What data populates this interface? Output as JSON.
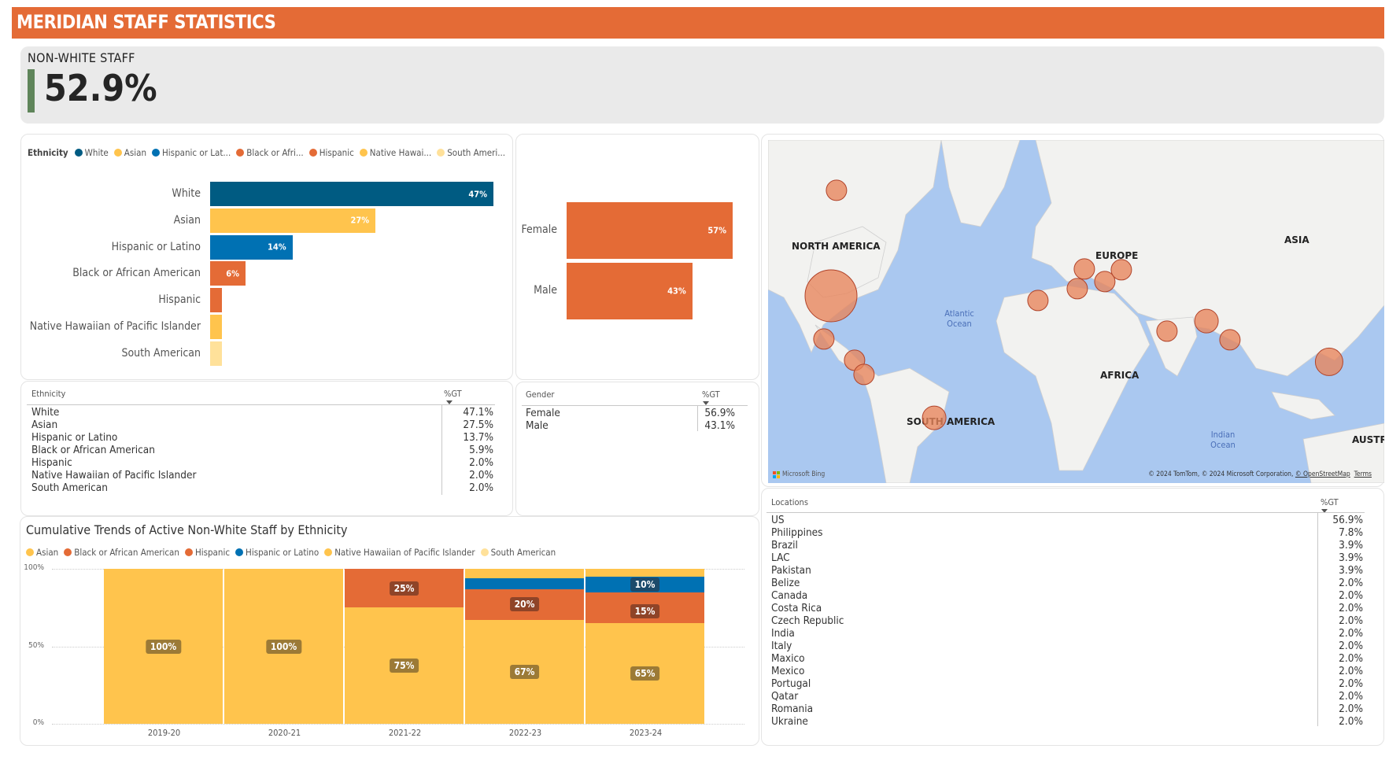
{
  "header": {
    "title": "MERIDIAN STAFF STATISTICS",
    "color": "#e46b36"
  },
  "kpi": {
    "label": "NON-WHITE STAFF",
    "value": "52.9%",
    "accent": "#5f855a"
  },
  "ethnicity_bar": {
    "legend_title": "Ethnicity",
    "legend": [
      {
        "label": "White",
        "color": "#005b82"
      },
      {
        "label": "Asian",
        "color": "#ffc44d"
      },
      {
        "label": "Hispanic or Lat...",
        "color": "#0071b3"
      },
      {
        "label": "Black or Afri...",
        "color": "#e46b36"
      },
      {
        "label": "Hispanic",
        "color": "#e46b36"
      },
      {
        "label": "Native Hawai...",
        "color": "#ffc44d"
      },
      {
        "label": "South Ameri...",
        "color": "#ffe19a"
      }
    ],
    "bars": [
      {
        "label": "White",
        "value": 47.1,
        "display": "47%",
        "color": "#005b82"
      },
      {
        "label": "Asian",
        "value": 27.5,
        "display": "27%",
        "color": "#ffc44d"
      },
      {
        "label": "Hispanic or Latino",
        "value": 13.7,
        "display": "14%",
        "color": "#0071b3"
      },
      {
        "label": "Black or African American",
        "value": 5.9,
        "display": "6%",
        "color": "#e46b36"
      },
      {
        "label": "Hispanic",
        "value": 2.0,
        "display": "",
        "color": "#e46b36"
      },
      {
        "label": "Native Hawaiian of Pacific Islander",
        "value": 2.0,
        "display": "",
        "color": "#ffc44d"
      },
      {
        "label": "South American",
        "value": 2.0,
        "display": "",
        "color": "#ffe19a"
      }
    ]
  },
  "gender_bar": {
    "bars": [
      {
        "label": "Female",
        "value": 56.9,
        "display": "57%",
        "color": "#e46b36"
      },
      {
        "label": "Male",
        "value": 43.1,
        "display": "43%",
        "color": "#e46b36"
      }
    ]
  },
  "ethnicity_table": {
    "col1": "Ethnicity",
    "col2": "%GT",
    "rows": [
      {
        "name": "White",
        "pct": "47.1%"
      },
      {
        "name": "Asian",
        "pct": "27.5%"
      },
      {
        "name": "Hispanic or Latino",
        "pct": "13.7%"
      },
      {
        "name": "Black or African American",
        "pct": "5.9%"
      },
      {
        "name": "Hispanic",
        "pct": "2.0%"
      },
      {
        "name": "Native Hawaiian of Pacific Islander",
        "pct": "2.0%"
      },
      {
        "name": "South American",
        "pct": "2.0%"
      }
    ]
  },
  "gender_table": {
    "col1": "Gender",
    "col2": "%GT",
    "rows": [
      {
        "name": "Female",
        "pct": "56.9%"
      },
      {
        "name": "Male",
        "pct": "43.1%"
      }
    ]
  },
  "map": {
    "continent_labels": [
      "NORTH AMERICA",
      "EUROPE",
      "ASIA",
      "AFRICA",
      "SOUTH AMERICA",
      "AUSTRAI"
    ],
    "ocean_labels": [
      "Atlantic Ocean",
      "Indian Ocean"
    ],
    "provider": "Microsoft Bing",
    "attribution": "© 2024 TomTom, © 2024 Microsoft Corporation,",
    "attribution_link": "© OpenStreetMap",
    "terms": "Terms",
    "bubbles": [
      {
        "location": "US",
        "pct": 56.9
      },
      {
        "location": "Canada",
        "pct": 2.0
      },
      {
        "location": "Mexico",
        "pct": 2.0
      },
      {
        "location": "Belize",
        "pct": 2.0
      },
      {
        "location": "Costa Rica",
        "pct": 2.0
      },
      {
        "location": "Brazil",
        "pct": 3.9
      },
      {
        "location": "Portugal",
        "pct": 2.0
      },
      {
        "location": "Czech Republic",
        "pct": 2.0
      },
      {
        "location": "Italy",
        "pct": 2.0
      },
      {
        "location": "Romania",
        "pct": 2.0
      },
      {
        "location": "Ukraine",
        "pct": 2.0
      },
      {
        "location": "Qatar",
        "pct": 2.0
      },
      {
        "location": "Pakistan",
        "pct": 3.9
      },
      {
        "location": "India",
        "pct": 2.0
      },
      {
        "location": "Philippines",
        "pct": 7.8
      }
    ]
  },
  "locations_table": {
    "col1": "Locations",
    "col2": "%GT",
    "rows": [
      {
        "name": "US",
        "pct": "56.9%"
      },
      {
        "name": "Philippines",
        "pct": "7.8%"
      },
      {
        "name": "Brazil",
        "pct": "3.9%"
      },
      {
        "name": "LAC",
        "pct": "3.9%"
      },
      {
        "name": "Pakistan",
        "pct": "3.9%"
      },
      {
        "name": "Belize",
        "pct": "2.0%"
      },
      {
        "name": "Canada",
        "pct": "2.0%"
      },
      {
        "name": "Costa Rica",
        "pct": "2.0%"
      },
      {
        "name": "Czech Republic",
        "pct": "2.0%"
      },
      {
        "name": "India",
        "pct": "2.0%"
      },
      {
        "name": "Italy",
        "pct": "2.0%"
      },
      {
        "name": "Maxico",
        "pct": "2.0%"
      },
      {
        "name": "Mexico",
        "pct": "2.0%"
      },
      {
        "name": "Portugal",
        "pct": "2.0%"
      },
      {
        "name": "Qatar",
        "pct": "2.0%"
      },
      {
        "name": "Romania",
        "pct": "2.0%"
      },
      {
        "name": "Ukraine",
        "pct": "2.0%"
      }
    ]
  },
  "chart_data": {
    "type": "bar",
    "stacked": "100%",
    "title": "Cumulative Trends of Active Non-White Staff by Ethnicity",
    "xlabel": "",
    "ylabel": "",
    "ylim": [
      0,
      100
    ],
    "yticks": [
      "0%",
      "50%",
      "100%"
    ],
    "grid": true,
    "legend_position": "top-left",
    "categories": [
      "2019-20",
      "2020-21",
      "2021-22",
      "2022-23",
      "2023-24"
    ],
    "series": [
      {
        "name": "Asian",
        "color": "#ffc44d",
        "label_bg": "#9c7a36",
        "values": [
          100,
          100,
          75,
          67,
          65
        ],
        "labels": [
          "100%",
          "100%",
          "75%",
          "67%",
          "65%"
        ]
      },
      {
        "name": "Black or African American",
        "color": "#e46b36",
        "label_bg": "#8f4428",
        "values": [
          0,
          0,
          25,
          20,
          15
        ],
        "labels": [
          "",
          "",
          "25%",
          "20%",
          "15%"
        ]
      },
      {
        "name": "Hispanic",
        "color": "#e46b36",
        "label_bg": "#8f4428",
        "values": [
          0,
          0,
          0,
          0,
          5
        ],
        "labels": [
          "",
          "",
          "",
          "",
          ""
        ]
      },
      {
        "name": "Hispanic or Latino",
        "color": "#0071b3",
        "label_bg": "#1b4a6b",
        "values": [
          0,
          0,
          0,
          7,
          10
        ],
        "labels": [
          "",
          "",
          "",
          "",
          "10%"
        ]
      },
      {
        "name": "Native Hawaiian of Pacific Islander",
        "color": "#ffc44d",
        "label_bg": "#9c7a36",
        "values": [
          0,
          0,
          0,
          6,
          5
        ],
        "labels": [
          "",
          "",
          "",
          "",
          ""
        ]
      },
      {
        "name": "South American",
        "color": "#ffe19a",
        "label_bg": "#9c7a36",
        "values": [
          0,
          0,
          0,
          0,
          0
        ],
        "labels": [
          "",
          "",
          "",
          "",
          ""
        ]
      }
    ]
  }
}
